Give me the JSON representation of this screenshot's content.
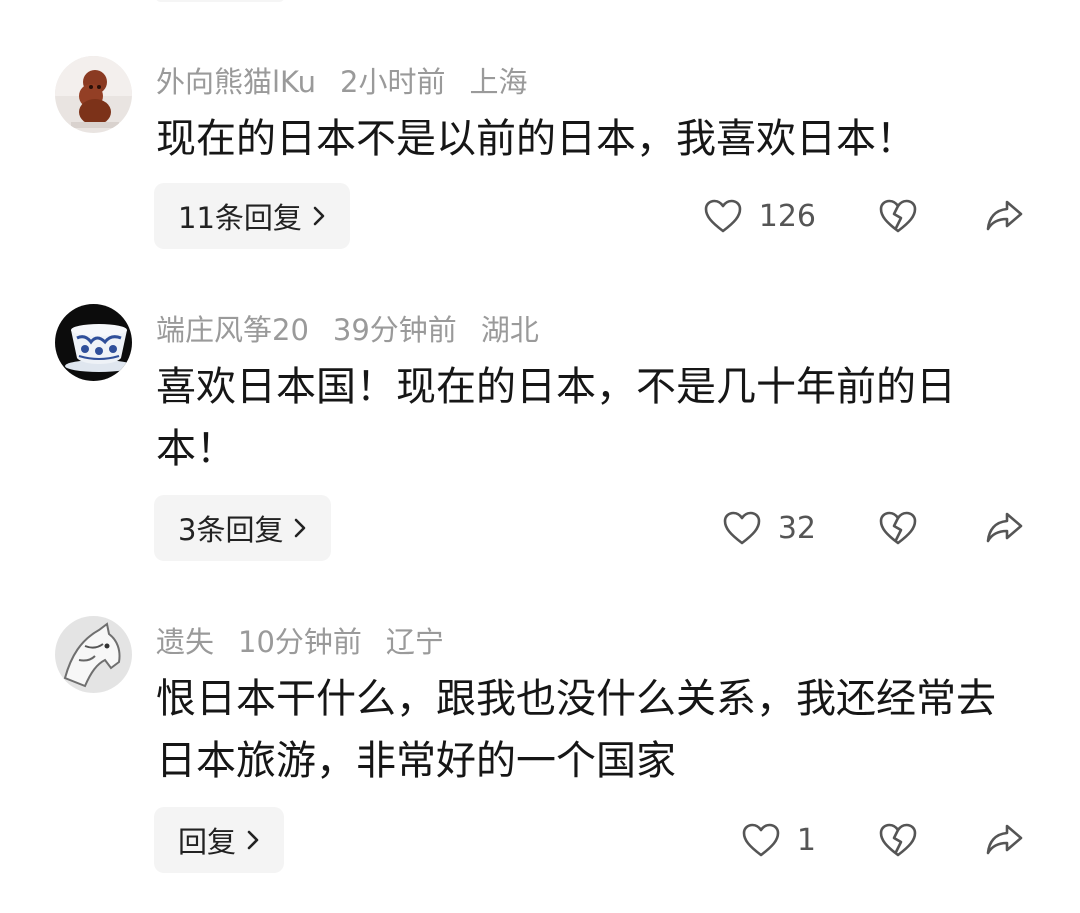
{
  "comments": [
    {
      "username": "外向熊猫lKu",
      "time": "2小时前",
      "location": "上海",
      "text": "现在的日本不是以前的日本，我喜欢日本！",
      "reply_label": "11条回复",
      "likes": "126"
    },
    {
      "username": "端庄风筝20",
      "time": "39分钟前",
      "location": "湖北",
      "text": "喜欢日本国！现在的日本，不是几十年前的日本！",
      "reply_label": "3条回复",
      "likes": "32"
    },
    {
      "username": "遗失",
      "time": "10分钟前",
      "location": "辽宁",
      "text": "恨日本干什么，跟我也没什么关系，我还经常去日本旅游，非常好的一个国家",
      "reply_label": "回复",
      "likes": "1"
    }
  ],
  "icons": {
    "like": "heart-outline",
    "dislike": "broken-heart-outline",
    "share": "share-arrow",
    "reply_chevron": "chevron-right"
  },
  "colors": {
    "meta_text": "#9a9a9a",
    "body_text": "#161616",
    "reply_bg": "#f4f4f4"
  }
}
